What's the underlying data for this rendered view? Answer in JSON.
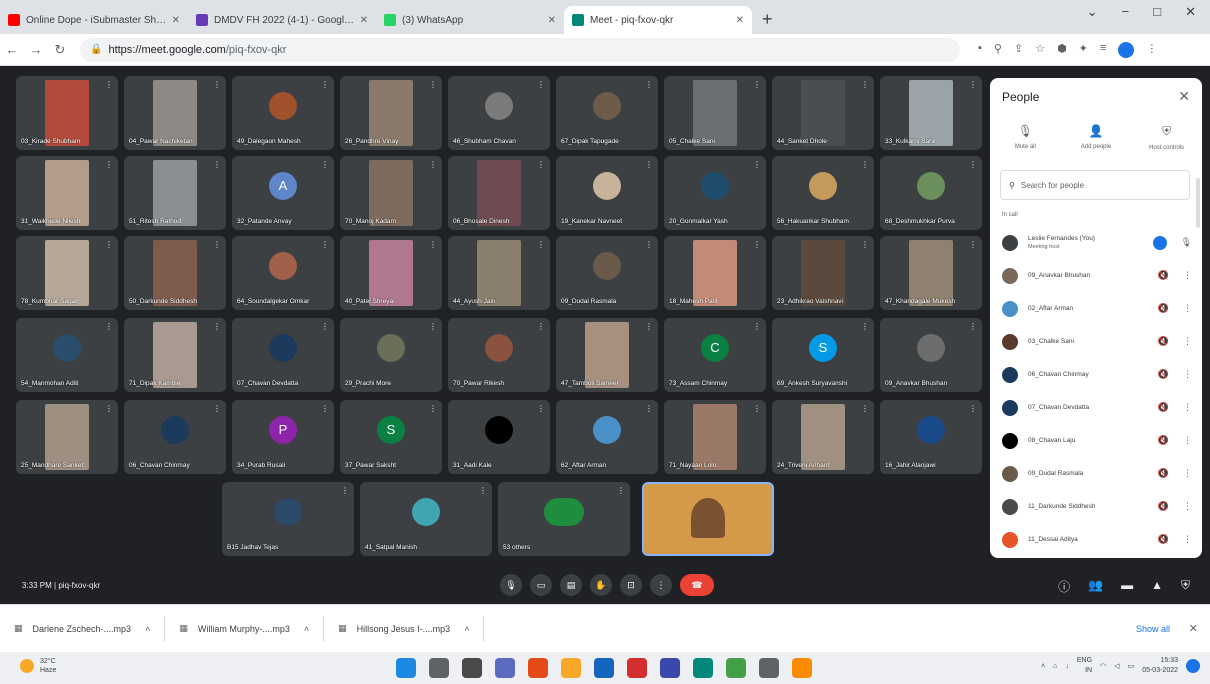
{
  "browser": {
    "tabs": [
      {
        "title": "Online Dope - iSubmaster Shorts",
        "favicon_color": "#ff0000",
        "active": false
      },
      {
        "title": "DMDV FH 2022 (4-1) - Google Form",
        "favicon_color": "#673ab7",
        "active": false
      },
      {
        "title": "(3) WhatsApp",
        "favicon_color": "#25d366",
        "active": false
      },
      {
        "title": "Meet - piq-fxov-qkr",
        "favicon_color": "#00897b",
        "active": true
      }
    ],
    "new_tab": "+",
    "window_controls": [
      "⌄",
      "−",
      "□",
      "✕"
    ],
    "url_host": "https://meet.google.com",
    "url_path": "/piq-fxov-qkr"
  },
  "meet": {
    "tiles": [
      {
        "name": "03_Kirade Shubham",
        "kind": "video",
        "color": "#b34a3a"
      },
      {
        "name": "04_Pawar Nachiketan",
        "kind": "video",
        "color": "#8d8a86"
      },
      {
        "name": "49_Dalegaon Mahesh",
        "kind": "avatar",
        "color": "#a0522d",
        "letter": ""
      },
      {
        "name": "26_Pandhre Vinay",
        "kind": "video",
        "color": "#8a7a6a"
      },
      {
        "name": "46_Shubham Chavan",
        "kind": "avatar",
        "color": "#7a7a7a",
        "letter": ""
      },
      {
        "name": "67_Dipak Tapugade",
        "kind": "avatar",
        "color": "#6d5c4a",
        "letter": ""
      },
      {
        "name": "05_Chalke Sani",
        "kind": "video",
        "color": "#6a6f73"
      },
      {
        "name": "44_Sanket Dhole",
        "kind": "video",
        "color": "#4a4d52"
      },
      {
        "name": "33_Kulkarni Sahil",
        "kind": "video",
        "color": "#9aa3a8"
      },
      {
        "name": "31_Waikhede Nilesh",
        "kind": "video",
        "color": "#b29c8a"
      },
      {
        "name": "51_Ritesh Rathod",
        "kind": "video",
        "color": "#8c8f92"
      },
      {
        "name": "32_Patande Anvay",
        "kind": "avatar",
        "color": "#5f86c9",
        "letter": "A"
      },
      {
        "name": "70_Manoj Kadam",
        "kind": "video",
        "color": "#7d6b5d"
      },
      {
        "name": "06_Bhosale Dinesh",
        "kind": "video",
        "color": "#6f4a52"
      },
      {
        "name": "19_Kanekar Navneet",
        "kind": "avatar",
        "color": "#c7b39a",
        "letter": ""
      },
      {
        "name": "20_Gonmalkar Yash",
        "kind": "avatar",
        "color": "#1e4e6b",
        "letter": ""
      },
      {
        "name": "56_Hakuankar Shubham",
        "kind": "avatar",
        "color": "#c49a5c",
        "letter": ""
      },
      {
        "name": "68_Deshmukhkar Purva",
        "kind": "avatar",
        "color": "#6a8f5a",
        "letter": ""
      },
      {
        "name": "78_Kumbhar Sagar",
        "kind": "video",
        "color": "#b5a898"
      },
      {
        "name": "50_Darkunde Siddhesh",
        "kind": "video",
        "color": "#7d5c4e"
      },
      {
        "name": "64_Soundalgekar Omkar",
        "kind": "avatar",
        "color": "#a0604a",
        "letter": ""
      },
      {
        "name": "40_Patel Shreya",
        "kind": "video",
        "color": "#b07890"
      },
      {
        "name": "44_Ayush Jain",
        "kind": "video",
        "color": "#8a7e6c"
      },
      {
        "name": "09_Dudal Rasmala",
        "kind": "avatar",
        "color": "#6a5a4a",
        "letter": ""
      },
      {
        "name": "18_Mahesh Patil",
        "kind": "video",
        "color": "#c48a78"
      },
      {
        "name": "23_Adhikrao Vaishnavi",
        "kind": "video",
        "color": "#5a4a3e"
      },
      {
        "name": "47_Khandagale Mukesh",
        "kind": "video",
        "color": "#8f8170"
      },
      {
        "name": "54_Manmohan Aditi",
        "kind": "avatar",
        "color": "#2a4d6b",
        "letter": ""
      },
      {
        "name": "71_Dipak Kamble",
        "kind": "video",
        "color": "#a89a90"
      },
      {
        "name": "07_Chavan Devdatta",
        "kind": "avatar",
        "color": "#1b3a5c",
        "letter": ""
      },
      {
        "name": "29_Prachi More",
        "kind": "avatar",
        "color": "#6b6f5a",
        "letter": ""
      },
      {
        "name": "70_Pawar Rikesh",
        "kind": "avatar",
        "color": "#8c5240",
        "letter": ""
      },
      {
        "name": "47_Tamboli Sameer",
        "kind": "video",
        "color": "#a89080"
      },
      {
        "name": "73_Assam Chinmay",
        "kind": "avatar",
        "color": "#0b8043",
        "letter": "C"
      },
      {
        "name": "69_Ankesh Suryavanshi",
        "kind": "avatar",
        "color": "#039be5",
        "letter": "S"
      },
      {
        "name": "09_Anavkar Bhushan",
        "kind": "avatar",
        "color": "#6d6d6d",
        "letter": ""
      },
      {
        "name": "25_Mandhare Sanket",
        "kind": "video",
        "color": "#9d9080"
      },
      {
        "name": "06_Chavan Chinmay",
        "kind": "avatar",
        "color": "#1b3a5c",
        "letter": ""
      },
      {
        "name": "34_Purab Rusali",
        "kind": "avatar",
        "color": "#8e24aa",
        "letter": "P"
      },
      {
        "name": "37_Pawar Saksht",
        "kind": "avatar",
        "color": "#0b8043",
        "letter": "S"
      },
      {
        "name": "31_Aadi Kale",
        "kind": "avatar",
        "color": "#000000",
        "letter": ""
      },
      {
        "name": "62_Aftar Arman",
        "kind": "avatar",
        "color": "#4a90c8",
        "letter": ""
      },
      {
        "name": "71_Nayaan Lolo",
        "kind": "video",
        "color": "#9a7868"
      },
      {
        "name": "24_Triveni Arihant",
        "kind": "video",
        "color": "#a09080"
      },
      {
        "name": "16_Jahir Alanjawi",
        "kind": "avatar",
        "color": "#1a4a8a",
        "letter": ""
      },
      {
        "name": "B15 Jadhav Tejas",
        "kind": "avatar",
        "color": "#2e4a6b",
        "letter": ""
      },
      {
        "name": "41_Satpal Manish",
        "kind": "avatar",
        "color": "#3fa5b0",
        "letter": ""
      },
      {
        "name": "53 others",
        "kind": "others",
        "color": "#3c4043",
        "letter": ""
      },
      {
        "name": "",
        "kind": "self",
        "color": "#d49a4a",
        "letter": ""
      }
    ],
    "meeting_time": "3:33 PM",
    "meeting_code": "piq-fxov-qkr",
    "controls": [
      "mic",
      "camera",
      "captions",
      "raise-hand",
      "present",
      "more",
      "end-call"
    ],
    "right_controls": [
      "info",
      "people",
      "chat",
      "activities",
      "host-controls"
    ]
  },
  "people_panel": {
    "title": "People",
    "close": "✕",
    "actions": [
      {
        "icon": "mute-all-icon",
        "label": "Mute all"
      },
      {
        "icon": "add-people-icon",
        "label": "Add people"
      },
      {
        "icon": "host-controls-icon",
        "label": "Host controls"
      }
    ],
    "search_placeholder": "Search for people",
    "section_label": "In call",
    "participants": [
      {
        "name": "Leslie Fernandes (You)",
        "sub": "Meeting host",
        "color": "#3c4043",
        "host": true
      },
      {
        "name": "09_Anavkar Bhushan",
        "sub": "",
        "color": "#7a6a5a",
        "host": false
      },
      {
        "name": "02_Aftar Arman",
        "sub": "",
        "color": "#4a90c8",
        "host": false
      },
      {
        "name": "03_Chalke Sani",
        "sub": "",
        "color": "#5a3a2e",
        "host": false
      },
      {
        "name": "06_Chavan Chinmay",
        "sub": "",
        "color": "#1b3a5c",
        "host": false
      },
      {
        "name": "07_Chavan Devdatta",
        "sub": "",
        "color": "#1b3a5c",
        "host": false
      },
      {
        "name": "08_Chavan Laju",
        "sub": "",
        "color": "#000000",
        "host": false
      },
      {
        "name": "09_Dudal Rasmala",
        "sub": "",
        "color": "#6a5a4a",
        "host": false
      },
      {
        "name": "11_Darkunde Siddhesh",
        "sub": "",
        "color": "#4a4a4a",
        "host": false
      },
      {
        "name": "11_Dessai Aditya",
        "sub": "",
        "color": "#e8542a",
        "host": false
      }
    ]
  },
  "downloads": {
    "items": [
      "Darlene Zschech-....mp3",
      "William Murphy-....mp3",
      "Hillsong Jesus I-....mp3"
    ],
    "show_all": "Show all",
    "close": "✕"
  },
  "taskbar": {
    "weather_temp": "32°C",
    "weather_desc": "Haze",
    "apps": [
      "#1e88e5",
      "#5f6368",
      "#4a4a4a",
      "#5c6bc0",
      "#e64a19",
      "#f9a825",
      "#1565c0",
      "#d32f2f",
      "#3949ab",
      "#00897b",
      "#43a047",
      "#5f6368",
      "#fb8c00"
    ],
    "lang": "ENG",
    "region": "IN",
    "time": "15:33",
    "date": "05-03-2022"
  }
}
